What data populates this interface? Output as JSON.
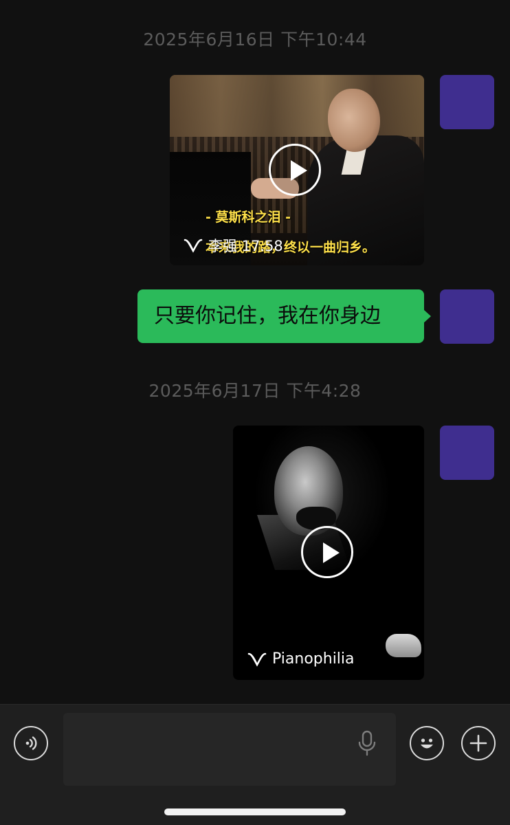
{
  "chat": {
    "timestamps": [
      "2025年6月16日 下午10:44",
      "2025年6月17日 下午4:28"
    ],
    "messages": [
      {
        "type": "video",
        "subtitle_title": "- 莫斯科之泪 -",
        "subtitle_line": "本来我的路，终以一曲归乡。",
        "watermark": "李强 17.58"
      },
      {
        "type": "text",
        "text": "只要你记住，我在你身边"
      },
      {
        "type": "video",
        "watermark": "Pianophilia"
      }
    ]
  },
  "input_bar": {
    "text_value": "",
    "icons": [
      "voice-icon",
      "microphone-icon",
      "emoji-icon",
      "plus-icon"
    ]
  },
  "colors": {
    "background": "#111111",
    "bubble_green": "#2bba5a",
    "avatar_purple": "#3f2e8f",
    "timestamp_gray": "#5c5c5c"
  }
}
